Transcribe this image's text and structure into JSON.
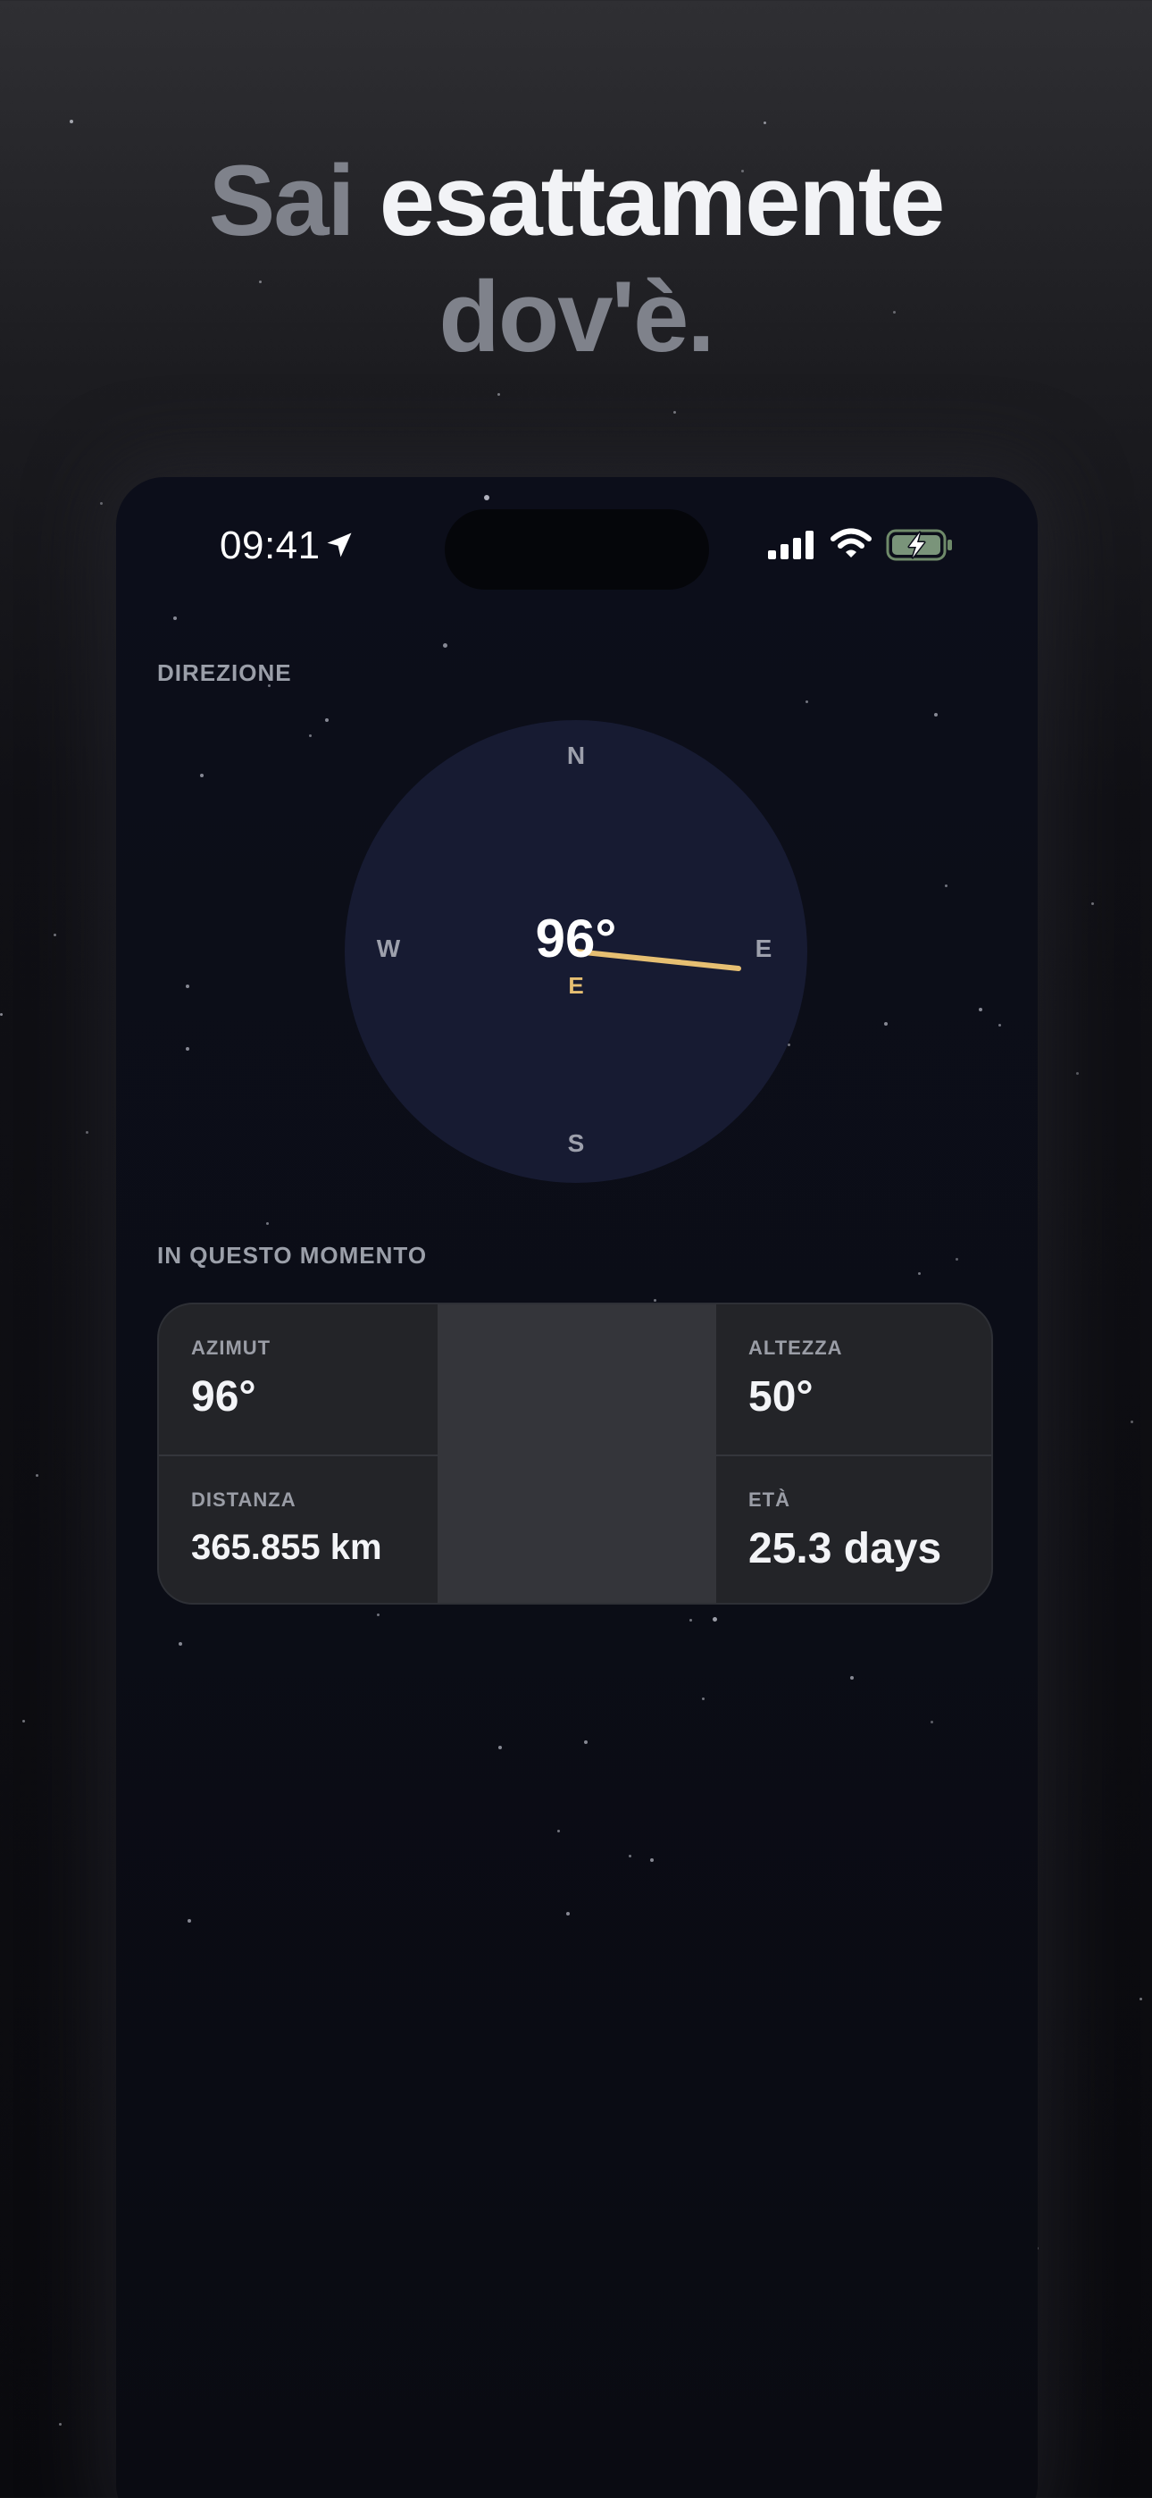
{
  "headline": {
    "word1": "Sai",
    "word2": "esattamente",
    "word3": "dov'è."
  },
  "status_bar": {
    "time": "09:41",
    "icons": [
      "location-arrow-icon",
      "cellular-signal-icon",
      "wifi-icon",
      "battery-charging-icon"
    ]
  },
  "direction": {
    "section_label": "DIREZIONE",
    "cardinals": {
      "north": "N",
      "east": "E",
      "south": "S",
      "west": "W"
    },
    "degrees": "96°",
    "direction_label": "E",
    "needle_color": "#e6bf72"
  },
  "now": {
    "section_label": "IN QUESTO MOMENTO",
    "stats": {
      "azimut": {
        "label": "AZIMUT",
        "value": "96°"
      },
      "altezza": {
        "label": "ALTEZZA",
        "value": "50°"
      },
      "distanza": {
        "label": "DISTANZA",
        "value": "365.855 km"
      },
      "eta": {
        "label": "ETÀ",
        "value": "25.3 days"
      }
    }
  }
}
